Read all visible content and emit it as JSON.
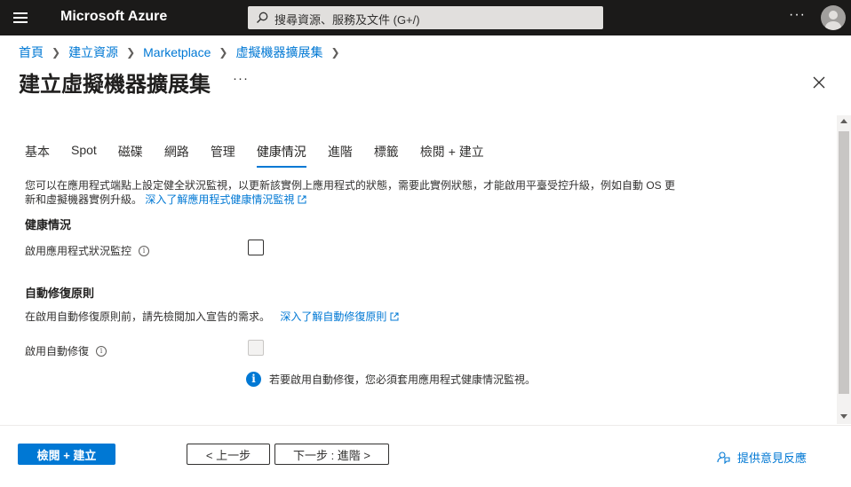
{
  "topbar": {
    "brand": "Microsoft Azure",
    "search_placeholder": "搜尋資源、服務及文件 (G+/)",
    "more": "···"
  },
  "breadcrumb": [
    "首頁",
    "建立資源",
    "Marketplace",
    "虛擬機器擴展集"
  ],
  "page": {
    "title": "建立虛擬機器擴展集",
    "more": "···"
  },
  "tabs": [
    {
      "label": "基本",
      "active": false
    },
    {
      "label": "Spot",
      "active": false
    },
    {
      "label": "磁碟",
      "active": false
    },
    {
      "label": "網路",
      "active": false
    },
    {
      "label": "管理",
      "active": false
    },
    {
      "label": "健康情況",
      "active": true
    },
    {
      "label": "進階",
      "active": false
    },
    {
      "label": "標籤",
      "active": false
    },
    {
      "label": "檢閱 + 建立",
      "active": false
    }
  ],
  "content": {
    "description": "您可以在應用程式端點上設定健全狀況監視，以更新該實例上應用程式的狀態，需要此實例狀態，才能啟用平臺受控升級，例如自動 OS 更新和虛擬機器實例升級。",
    "description_link": "深入了解應用程式健康情況監視",
    "health_heading": "健康情況",
    "app_health_label": "啟用應用程式狀況監控",
    "app_health_checked": false,
    "repair_heading": "自動修復原則",
    "repair_text": "在啟用自動修復原則前，請先檢閱加入宣告的需求。",
    "repair_link": "深入了解自動修復原則",
    "auto_repair_label": "啟用自動修復",
    "auto_repair_checked": false,
    "auto_repair_disabled": true,
    "info_message": "若要啟用自動修復，您必須套用應用程式健康情況監視。"
  },
  "footer": {
    "review_create": "檢閱 + 建立",
    "previous": "< 上一步",
    "next": "下一步 : 進階 >",
    "feedback": "提供意見反應"
  },
  "colors": {
    "accent": "#0078d4",
    "topbar": "#1b1a19"
  }
}
